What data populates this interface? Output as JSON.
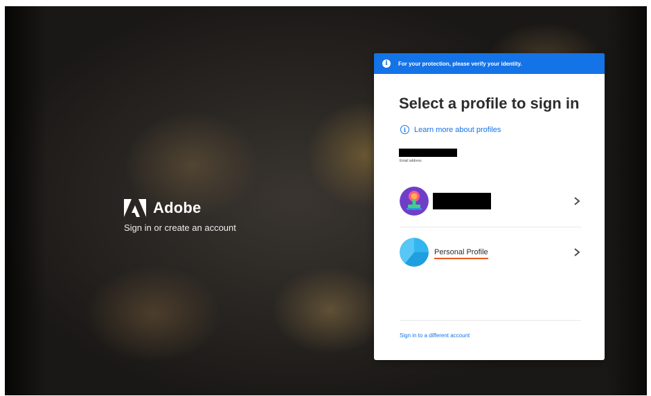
{
  "background": {
    "description_icon": "food-photo"
  },
  "brand": {
    "name": "Adobe",
    "tagline": "Sign in or create an account"
  },
  "banner": {
    "text": "For your protection, please verify your identity."
  },
  "card": {
    "title": "Select a profile to sign in",
    "learn_more": "Learn more about profiles",
    "email_label": "Email address",
    "profiles": [
      {
        "name": "",
        "avatar": "stamp-avatar-icon",
        "redacted": true
      },
      {
        "name": "Personal Profile",
        "avatar": "pie-avatar-icon"
      }
    ],
    "different_account": "Sign in to a different account"
  },
  "colors": {
    "accent": "#1473e6",
    "highlight": "#e35a1c"
  }
}
